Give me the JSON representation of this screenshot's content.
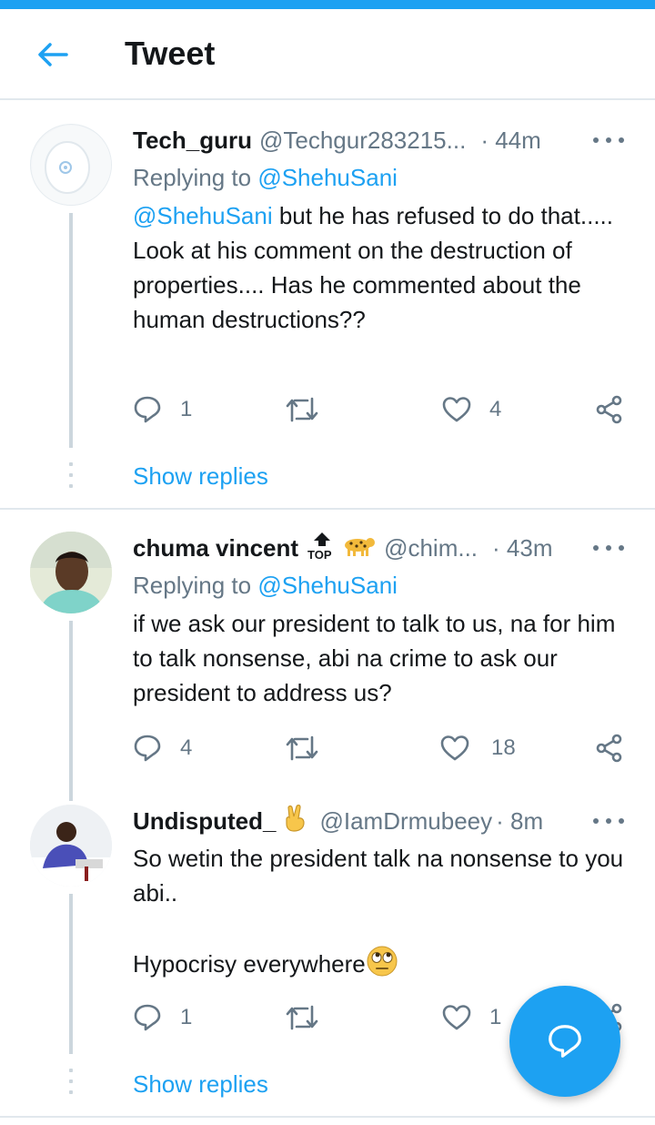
{
  "header": {
    "title": "Tweet",
    "back_icon": "arrow-left-icon"
  },
  "colors": {
    "accent": "#1da1f2",
    "text": "#14171a",
    "muted": "#657786",
    "border": "#e1e8ed"
  },
  "tweets": [
    {
      "name": "Tech_guru",
      "handle": "@Techgur283215...",
      "time": "· 44m",
      "replying_prefix": "Replying to",
      "replying_to": "@ShehuSani",
      "mention": "@ShehuSani",
      "text": " but he has refused to do that..... Look at his comment on the destruction of properties.... Has he commented about the human destructions??",
      "replies": "1",
      "retweets": "",
      "likes": "4",
      "show_replies": "Show replies"
    },
    {
      "name": "chuma vincent",
      "handle": "@chim...",
      "time": "· 43m",
      "replying_prefix": "Replying to",
      "replying_to": "@ShehuSani",
      "text": "if we ask our president to talk to us, na for him to talk nonsense, abi na crime to ask our president to address us?",
      "replies": "4",
      "retweets": "",
      "likes": "18"
    },
    {
      "name": "Undisputed_",
      "handle": "@IamDrmubeey",
      "time": "· 8m",
      "text_line1": "So wetin the president talk na nonsense to you abi..",
      "text_line2": "Hypocrisy everywhere",
      "replies": "1",
      "retweets": "",
      "likes": "1",
      "show_replies": "Show replies"
    }
  ],
  "fab": {
    "icon": "reply-bubble-icon"
  }
}
